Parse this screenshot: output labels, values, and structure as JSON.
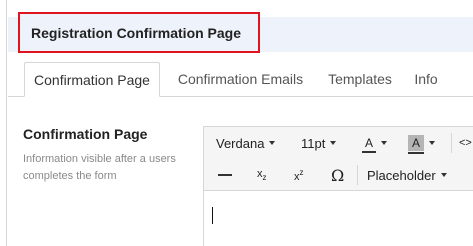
{
  "header": {
    "title": "Registration Confirmation Page"
  },
  "tabs": [
    {
      "label": "Confirmation Page",
      "active": true
    },
    {
      "label": "Confirmation Emails",
      "active": false
    },
    {
      "label": "Templates",
      "active": false
    },
    {
      "label": "Info",
      "active": false
    }
  ],
  "section": {
    "title": "Confirmation Page",
    "description": "Information visible after a users completes the form"
  },
  "editor": {
    "toolbar": {
      "font_family": "Verdana",
      "font_size": "11pt",
      "font_color_glyph": "A",
      "bg_color_glyph": "A",
      "source_glyph": "<>",
      "subscript_glyph": "x",
      "subscript_mark": "z",
      "superscript_glyph": "x",
      "superscript_mark": "z",
      "special_char_glyph": "Ω",
      "placeholder_label": "Placeholder"
    },
    "content": ""
  },
  "colors": {
    "highlight_border": "#e0141e",
    "header_band": "#eef3fb",
    "toolbar_bg": "#f5f5f5",
    "bg_color_swatch": "#b5b5b5"
  },
  "icons": {
    "horizontal_rule": "horizontal-rule-icon",
    "subscript": "subscript-icon",
    "superscript": "superscript-icon",
    "special_char": "omega-icon",
    "source_code": "source-code-icon"
  }
}
